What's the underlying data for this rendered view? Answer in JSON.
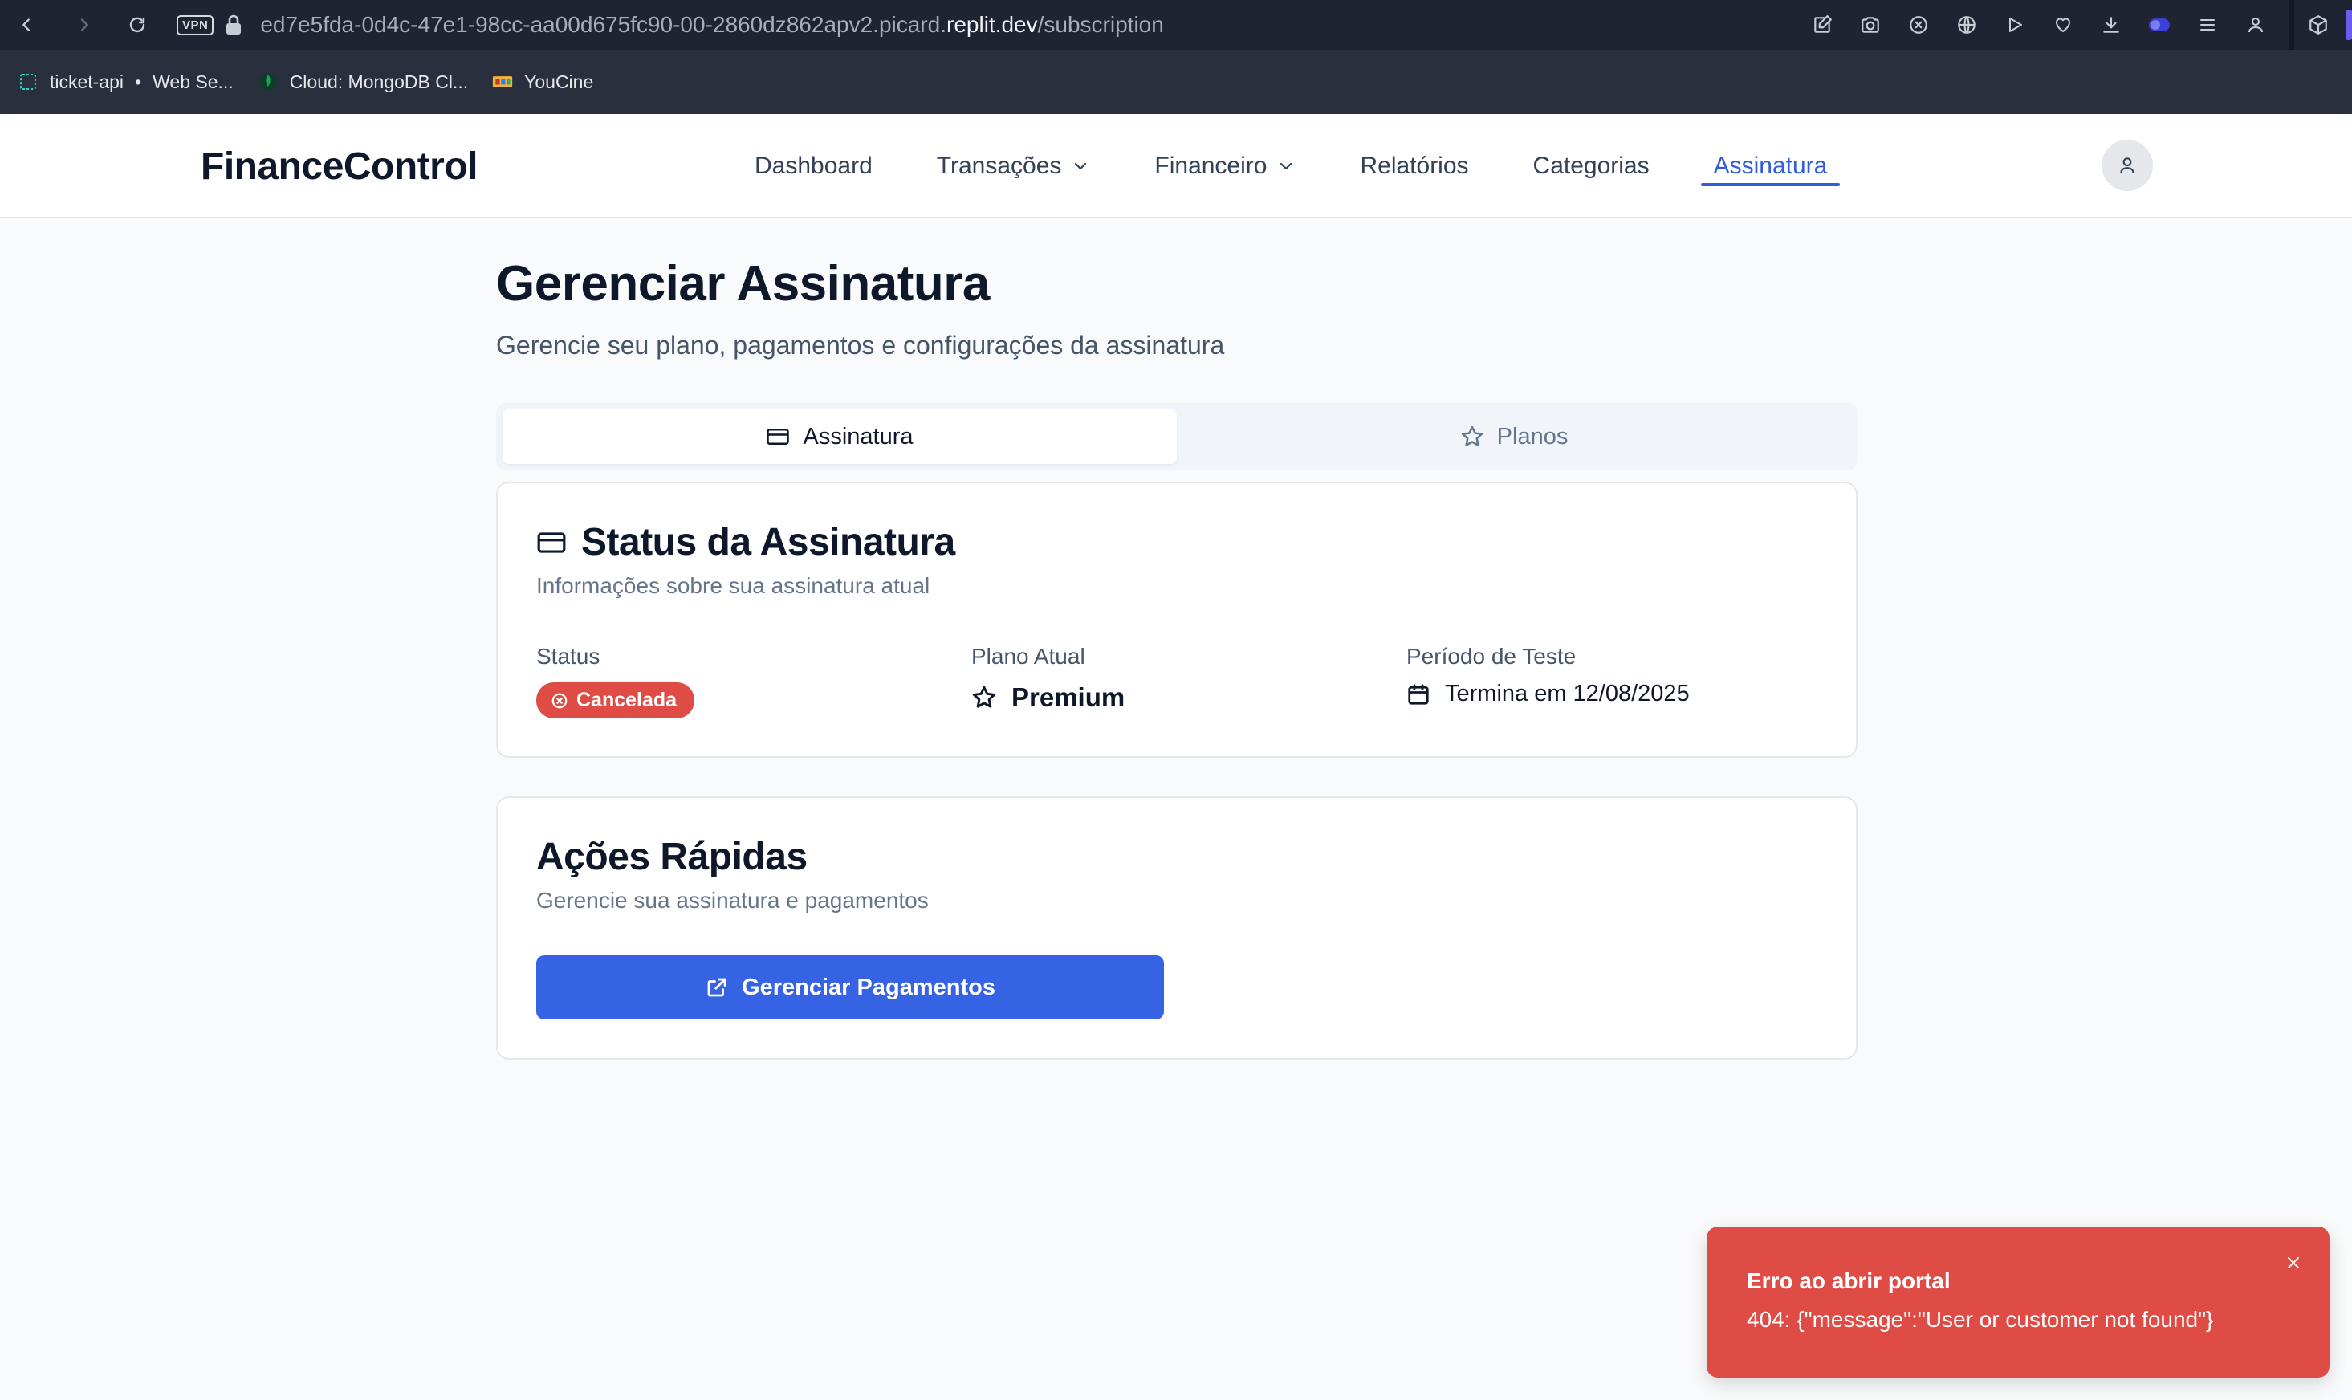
{
  "browser": {
    "vpn_label": "VPN",
    "url_prefix": "ed7e5fda-0d4c-47e1-98cc-aa00d675fc90-00-2860dz862apv2.picard.",
    "url_host": "replit.dev",
    "url_path": "/subscription",
    "bookmarks": [
      {
        "label": "ticket-api",
        "icon": "grid-icon",
        "extra": "Web Se..."
      },
      {
        "label": "Cloud: MongoDB Cl...",
        "icon": "leaf-icon"
      },
      {
        "label": "YouCine",
        "icon": "film-icon"
      }
    ]
  },
  "app": {
    "brand": "FinanceControl",
    "nav": [
      {
        "label": "Dashboard"
      },
      {
        "label": "Transações",
        "dropdown": true
      },
      {
        "label": "Financeiro",
        "dropdown": true
      },
      {
        "label": "Relatórios"
      },
      {
        "label": "Categorias"
      },
      {
        "label": "Assinatura",
        "active": true
      }
    ]
  },
  "page": {
    "title": "Gerenciar Assinatura",
    "subtitle": "Gerencie seu plano, pagamentos e configurações da assinatura",
    "tabs": [
      {
        "label": "Assinatura",
        "icon": "credit-card-icon",
        "active": true
      },
      {
        "label": "Planos",
        "icon": "star-icon",
        "active": false
      }
    ]
  },
  "status_card": {
    "title": "Status da Assinatura",
    "description": "Informações sobre sua assinatura atual",
    "status_label": "Status",
    "status_value": "Cancelada",
    "plan_label": "Plano Atual",
    "plan_value": "Premium",
    "trial_label": "Período de Teste",
    "trial_value": "Termina em 12/08/2025"
  },
  "actions_card": {
    "title": "Ações Rápidas",
    "description": "Gerencie sua assinatura e pagamentos",
    "button_label": "Gerenciar Pagamentos"
  },
  "toast": {
    "title": "Erro ao abrir portal",
    "message": "404: {\"message\":\"User or customer not found\"}"
  },
  "colors": {
    "primary": "#3563e3",
    "danger": "#df4b45",
    "nav_active": "#2f5ce0"
  }
}
